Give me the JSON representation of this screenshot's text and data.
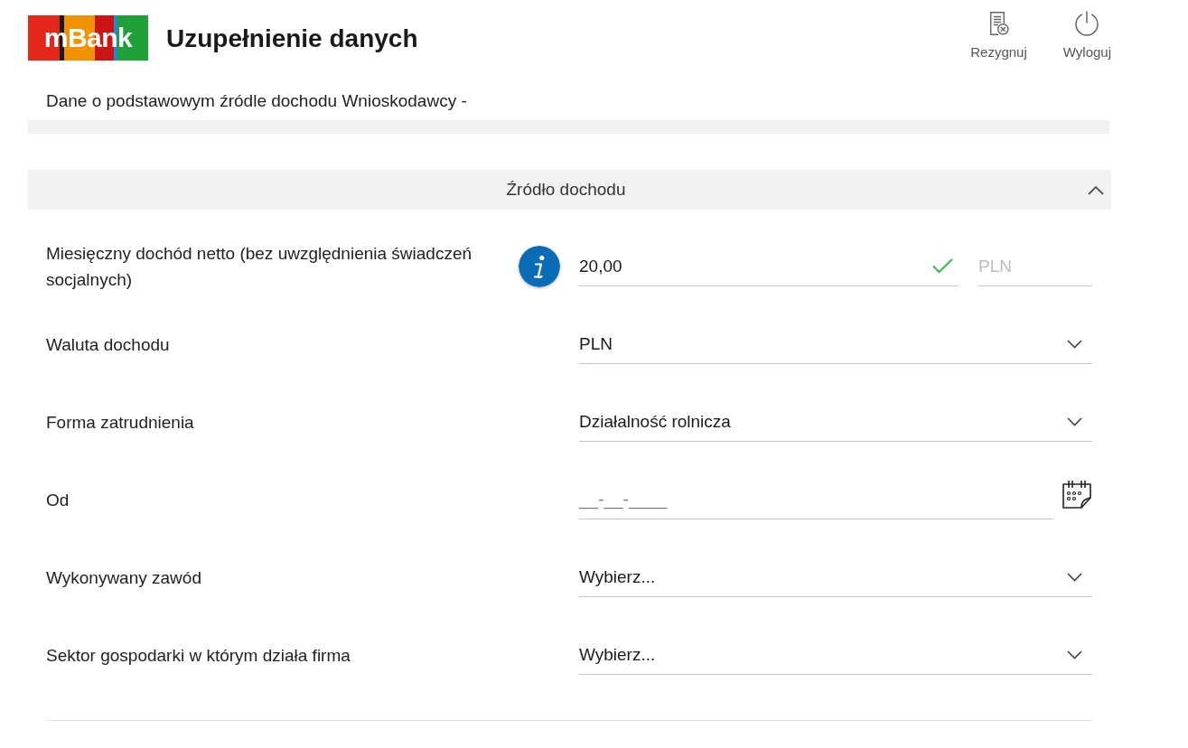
{
  "header": {
    "logo": "mBank",
    "title": "Uzupełnienie danych",
    "actions": [
      {
        "kind": "cancel",
        "label": "Rezygnuj"
      },
      {
        "kind": "logout",
        "label": "Wyloguj"
      }
    ]
  },
  "subtitle": "Dane o podstawowym źródle dochodu Wnioskodawcy -",
  "section": {
    "title": "Źródło dochodu",
    "expanded": true,
    "fields": [
      {
        "kind": "amount",
        "label": "Miesięczny dochód netto (bez uwzględnienia świadczeń socjalnych)",
        "info": true,
        "value": "20,00",
        "valid": true,
        "currency": {
          "value": "PLN",
          "disabled": true
        }
      },
      {
        "kind": "select",
        "label": "Waluta dochodu",
        "value": "PLN"
      },
      {
        "kind": "select",
        "label": "Forma zatrudnienia",
        "value": "Działalność rolnicza"
      },
      {
        "kind": "date",
        "label": "Od",
        "placeholder": "__-__-____"
      },
      {
        "kind": "select",
        "label": "Wykonywany zawód",
        "value": "Wybierz..."
      },
      {
        "kind": "select",
        "label": "Sektor gospodarki w którym działa firma",
        "value": "Wybierz..."
      }
    ]
  }
}
